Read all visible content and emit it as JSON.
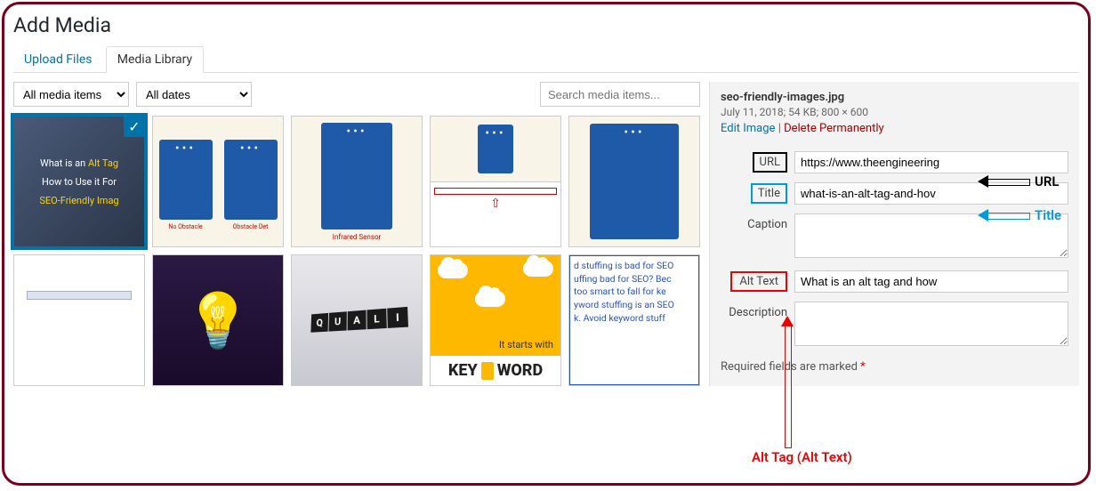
{
  "page_title": "Add Media",
  "tabs": {
    "upload": "Upload Files",
    "library": "Media Library"
  },
  "filters": {
    "media_type": "All media items",
    "dates": "All dates",
    "search_placeholder": "Search media items..."
  },
  "thumbs": {
    "t1_l1": "What is an ",
    "t1_l1b": "Alt Tag",
    "t1_l2": "How to Use it For",
    "t1_l3": "SEO-Friendly Imag",
    "t2_lbl1": "No Obstacle",
    "t2_lbl2": "Obstacle Det",
    "t3_lbl": "Infrared Sensor",
    "t8_letters": [
      "Q",
      "U",
      "A",
      "L",
      "I"
    ],
    "t9_starts": "It starts with",
    "t9_key": "KEY",
    "t9_word": "WORD",
    "t10_text": "d stuffing is bad for SEO\nuffing bad for SEO? Bec\ntoo smart to fall for ke\nyword stuffing is an SEO\nk. Avoid keyword stuff"
  },
  "details": {
    "filename": "seo-friendly-images.jpg",
    "meta": "July 11, 2018; 54 KB; 800 × 600",
    "edit": "Edit Image",
    "delete": "Delete Permanently",
    "labels": {
      "url": "URL",
      "title": "Title",
      "caption": "Caption",
      "alt": "Alt Text",
      "desc": "Description"
    },
    "values": {
      "url": "https://www.theengineering",
      "title": "what-is-an-alt-tag-and-hov",
      "caption": "",
      "alt": "What is an alt tag and how",
      "desc": ""
    },
    "required": "Required fields are marked ",
    "required_star": "*"
  },
  "annotations": {
    "url": "URL",
    "title": "Title",
    "alt": "Alt Tag (Alt Text)"
  }
}
